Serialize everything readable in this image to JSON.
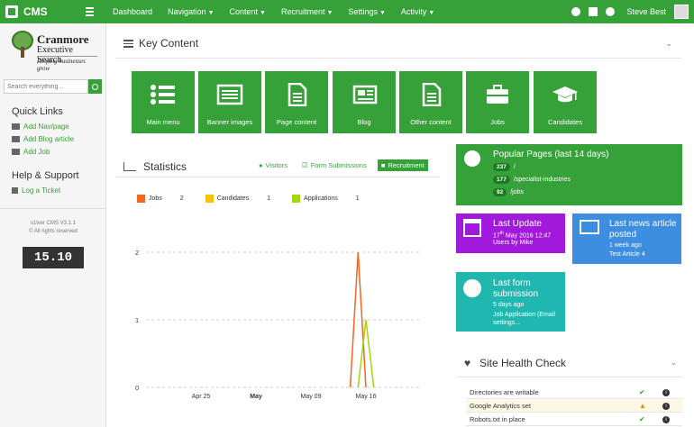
{
  "topbar": {
    "app_name": "CMS",
    "nav": [
      {
        "label": "Dashboard",
        "caret": false
      },
      {
        "label": "Navigation",
        "caret": true
      },
      {
        "label": "Content",
        "caret": true
      },
      {
        "label": "Recruitment",
        "caret": true
      },
      {
        "label": "Settings",
        "caret": true
      },
      {
        "label": "Activity",
        "caret": true
      }
    ],
    "user_name": "Steve Best"
  },
  "sidebar": {
    "brand_name": "Cranmore",
    "brand_sub": "Executive Search",
    "brand_tagline": "Helping businesses grow",
    "search_placeholder": "Search everything...",
    "quick_links_title": "Quick Links",
    "quick_links": [
      "Add Nav/page",
      "Add Blog article",
      "Add Job"
    ],
    "help_title": "Help & Support",
    "help_links": [
      "Log a Ticket"
    ],
    "version": "s1lver CMS V3.1.1",
    "rights": "© All rights reserved",
    "version_badge": "15.10"
  },
  "key_content": {
    "title": "Key Content",
    "tiles": [
      {
        "label": "Main menu",
        "icon": "list-icon"
      },
      {
        "label": "Banner images",
        "icon": "image-icon"
      },
      {
        "label": "Page content",
        "icon": "document-icon"
      },
      {
        "label": "Blog",
        "icon": "newspaper-icon"
      },
      {
        "label": "Other content",
        "icon": "file-icon"
      },
      {
        "label": "Jobs",
        "icon": "briefcase-icon"
      },
      {
        "label": "Candidates",
        "icon": "graduation-cap-icon"
      }
    ]
  },
  "statistics": {
    "title": "Statistics",
    "tabs": [
      "Visitors",
      "Form Submissions",
      "Recruitment"
    ],
    "active_tab": "Recruitment"
  },
  "chart_data": {
    "type": "line",
    "series": [
      {
        "name": "Jobs",
        "total": 2,
        "color": "#f26522",
        "points": [
          [
            "2016-05-14",
            0
          ],
          [
            "2016-05-15",
            2
          ],
          [
            "2016-05-16",
            0
          ]
        ]
      },
      {
        "name": "Candidates",
        "total": 1,
        "color": "#f5c400",
        "points": []
      },
      {
        "name": "Applications",
        "total": 1,
        "color": "#a6d608",
        "points": [
          [
            "2016-05-15",
            0
          ],
          [
            "2016-05-16",
            1
          ],
          [
            "2016-05-17",
            0
          ]
        ]
      }
    ],
    "x_ticks": [
      "Apr 25",
      "May",
      "May 09",
      "May 16"
    ],
    "x_range": [
      "2016-04-18",
      "2016-05-23"
    ],
    "y_ticks": [
      "0",
      "1",
      "2"
    ],
    "ylim": [
      0,
      2
    ],
    "grid": true
  },
  "popular_pages": {
    "title": "Popular Pages (last 14 days)",
    "items": [
      {
        "count": "237",
        "path": "/"
      },
      {
        "count": "177",
        "path": "/specialist-industries"
      },
      {
        "count": "92",
        "path": "/jobs"
      }
    ]
  },
  "last_update": {
    "title": "Last Update",
    "day": "17",
    "day_suffix": "th",
    "rest": " May 2016 12:47",
    "by": "Users by Mike"
  },
  "last_news": {
    "title": "Last news article posted",
    "when": "1 week ago",
    "item": "Test Article 4"
  },
  "last_form": {
    "title": "Last form submission",
    "when": "5 days ago",
    "item": "Job Application (Email settings..."
  },
  "site_health": {
    "title": "Site Health Check",
    "rows": [
      {
        "label": "Directories are writable",
        "status": "ok"
      },
      {
        "label": "Google Analytics set",
        "status": "warn"
      },
      {
        "label": "Robots.txt in place",
        "status": "ok"
      }
    ]
  },
  "colors": {
    "brand_green": "#37a139",
    "purple": "#a11adb",
    "blue": "#3d8de0",
    "teal": "#1fb7b0"
  }
}
